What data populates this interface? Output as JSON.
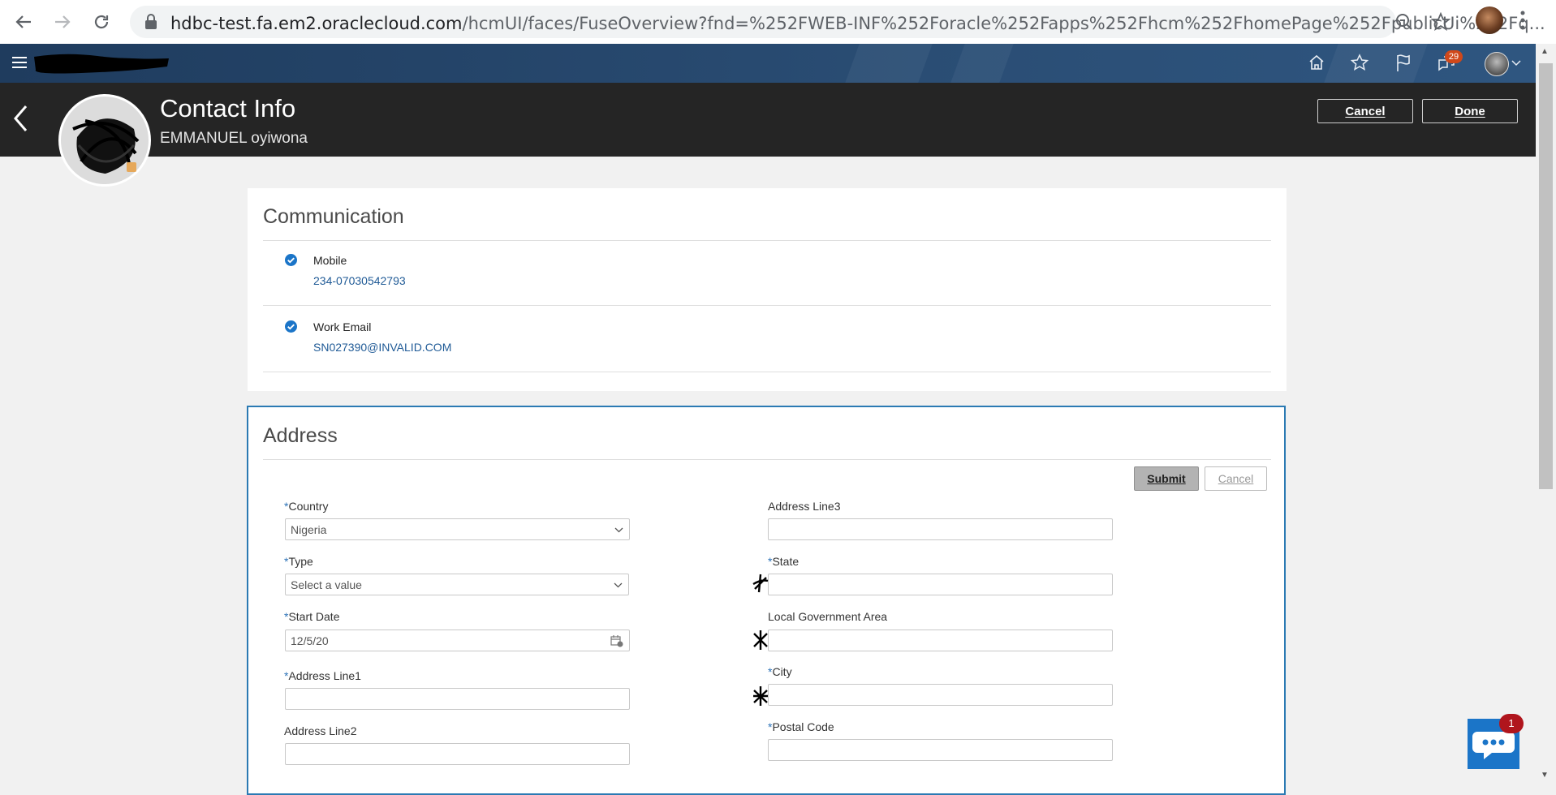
{
  "browser": {
    "url_host": "hdbc-test.fa.em2.oraclecloud.com",
    "url_path": "/hcmUI/faces/FuseOverview?fnd=%252FWEB-INF%252Foracle%252Fapps%252Fhcm%252FhomePage%252FpublicUi%252Fq..."
  },
  "global_header": {
    "notification_count": "29"
  },
  "page": {
    "title": "Contact Info",
    "person_name": "EMMANUEL oyiwona",
    "cancel_label": "Cancel",
    "done_label": "Done"
  },
  "communication": {
    "title": "Communication",
    "items": [
      {
        "label": "Mobile",
        "value": "234-07030542793"
      },
      {
        "label": "Work Email",
        "value": "SN027390@INVALID.COM"
      }
    ]
  },
  "address": {
    "title": "Address",
    "submit_label": "Submit",
    "cancel_label": "Cancel",
    "required_marker": "*",
    "fields": {
      "country": {
        "label": "Country",
        "value": "Nigeria"
      },
      "type": {
        "label": "Type",
        "value": "Select a value"
      },
      "start_date": {
        "label": "Start Date",
        "value": "12/5/20"
      },
      "address_line1": {
        "label": "Address Line1",
        "value": ""
      },
      "address_line2": {
        "label": "Address Line2",
        "value": ""
      },
      "address_line3": {
        "label": "Address Line3",
        "value": ""
      },
      "state": {
        "label": "State",
        "value": ""
      },
      "lga": {
        "label": "Local Government Area",
        "value": ""
      },
      "city": {
        "label": "City",
        "value": ""
      },
      "postal_code": {
        "label": "Postal Code",
        "value": ""
      }
    }
  },
  "chat": {
    "badge_count": "1"
  },
  "colors": {
    "header_dark": "#252525",
    "global_header": "#2a4d74",
    "link_blue": "#1f5a96",
    "check_blue": "#1b75c8",
    "required_blue": "#2d73b8",
    "chat_badge": "#b0151d"
  }
}
